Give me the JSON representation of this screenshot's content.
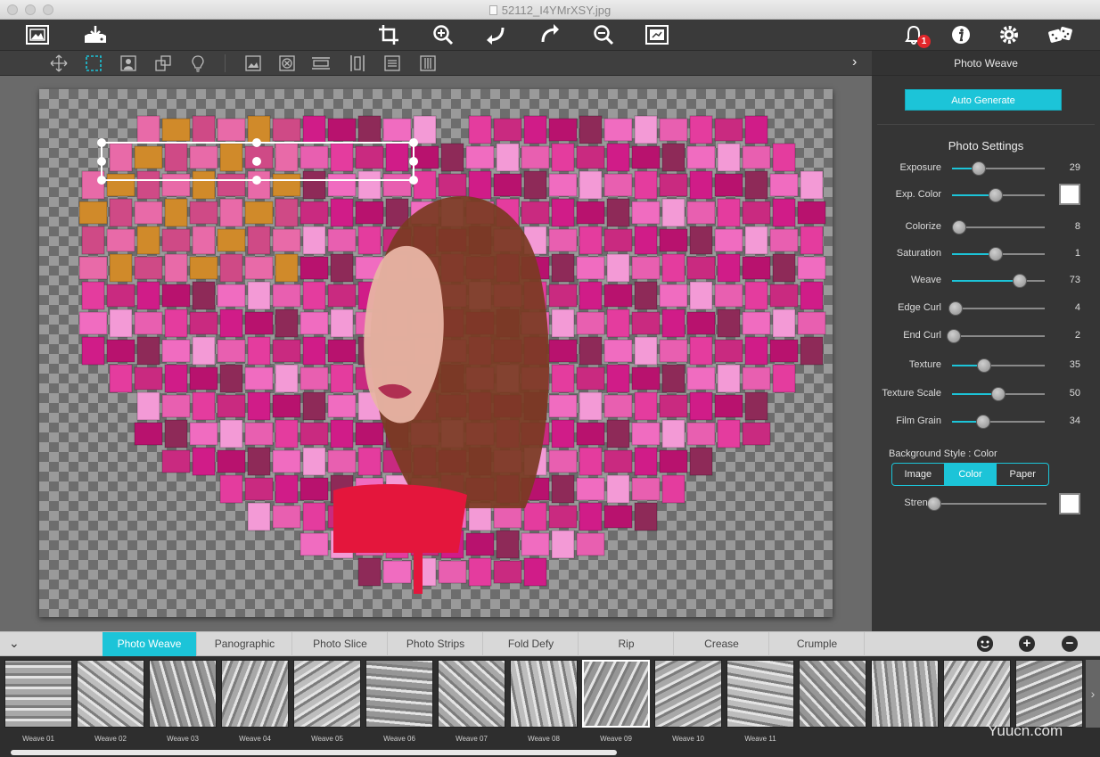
{
  "window": {
    "title": "52112_I4YMrXSY.jpg"
  },
  "toolbar": {
    "left_icons": [
      "open-image-icon",
      "export-icon"
    ],
    "center_icons": [
      "crop-icon",
      "zoom-in-icon",
      "undo-icon",
      "redo-icon",
      "zoom-out-icon",
      "fit-image-icon"
    ],
    "right_icons": [
      "bell-icon",
      "info-icon",
      "settings-icon",
      "dice-icon"
    ],
    "notification_count": "1"
  },
  "toolbar2": {
    "icons": [
      "move-icon",
      "select-rect-icon",
      "select-person-icon",
      "transform-icon",
      "bulb-icon",
      "image-icon",
      "remove-icon",
      "align-horizontal-icon",
      "align-vertical-icon",
      "distribute-icon",
      "grid-columns-icon"
    ]
  },
  "panel": {
    "header_title": "Photo Weave",
    "auto_generate": "Auto Generate",
    "settings_title": "Photo Settings",
    "sliders": [
      {
        "label": "Exposure",
        "value": "29",
        "pos": 0.29
      },
      {
        "label": "Exp. Color",
        "value": "",
        "pos": 0.47,
        "swatch": "#ffffff"
      },
      {
        "label": "Colorize",
        "value": "8",
        "pos": 0.08
      },
      {
        "label": "Saturation",
        "value": "1",
        "pos": 0.47
      },
      {
        "label": "Weave",
        "value": "73",
        "pos": 0.73
      },
      {
        "label": "Edge Curl",
        "value": "4",
        "pos": 0.04
      },
      {
        "label": "End Curl",
        "value": "2",
        "pos": 0.02
      },
      {
        "label": "Texture",
        "value": "35",
        "pos": 0.35
      },
      {
        "label": "Texture Scale",
        "value": "50",
        "pos": 0.5
      },
      {
        "label": "Film Grain",
        "value": "34",
        "pos": 0.34
      }
    ],
    "background_style_label": "Background Style : Color",
    "background_options": [
      "Image",
      "Color",
      "Paper"
    ],
    "background_selected": "Color",
    "strength_label": "Strength",
    "strength_pos": 0.0,
    "strength_swatch": "#ffffff"
  },
  "tabs": {
    "items": [
      "Photo Weave",
      "Panographic",
      "Photo Slice",
      "Photo Strips",
      "Fold Defy",
      "Rip",
      "Crease",
      "Crumple"
    ],
    "active": "Photo Weave",
    "collapse_icon": "chevron-down-icon",
    "action_icons": [
      "smiley-icon",
      "plus-icon",
      "minus-icon"
    ]
  },
  "presets": {
    "items": [
      "Weave 01",
      "Weave 02",
      "Weave 03",
      "Weave 04",
      "Weave 05",
      "Weave 06",
      "Weave 07",
      "Weave 08",
      "Weave 09",
      "Weave 10",
      "Weave 11",
      "",
      "",
      "",
      ""
    ],
    "selected": "Weave 09"
  },
  "watermark": "Yuucn.com",
  "colors": {
    "accent": "#1cc4d8",
    "badge": "#e2262a"
  }
}
